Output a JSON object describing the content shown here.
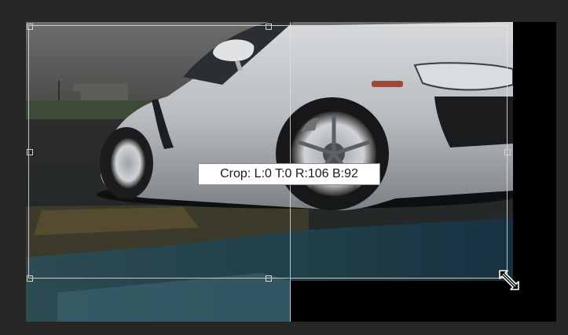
{
  "crop_overlay": {
    "label": "Crop: L:0 T:0 R:106 B:92"
  },
  "icons": {
    "cursor": "resize-diagonal-cursor-icon"
  },
  "colors": {
    "background": "#262626",
    "guide": "#e1e1e1",
    "tooltip_bg": "#ffffff"
  }
}
